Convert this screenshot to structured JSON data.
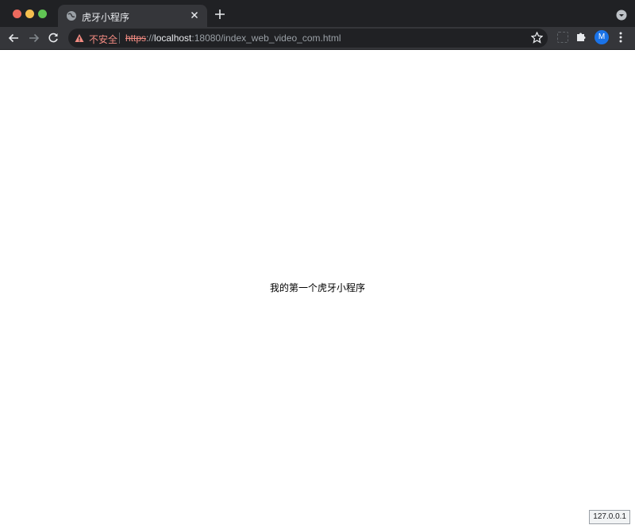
{
  "tab": {
    "title": "虎牙小程序"
  },
  "omnibox": {
    "security_label": "不安全",
    "scheme": "https",
    "scheme_sep": "://",
    "host": "localhost",
    "rest": ":18080/index_web_video_com.html"
  },
  "profile": {
    "initial": "M"
  },
  "page": {
    "text": "我的第一个虎牙小程序"
  },
  "status_bar": {
    "text": "127.0.0.1"
  },
  "colors": {
    "accent": "#1a73e8",
    "warning": "#f28b82",
    "chrome_dark": "#202124",
    "toolbar": "#35363a"
  }
}
